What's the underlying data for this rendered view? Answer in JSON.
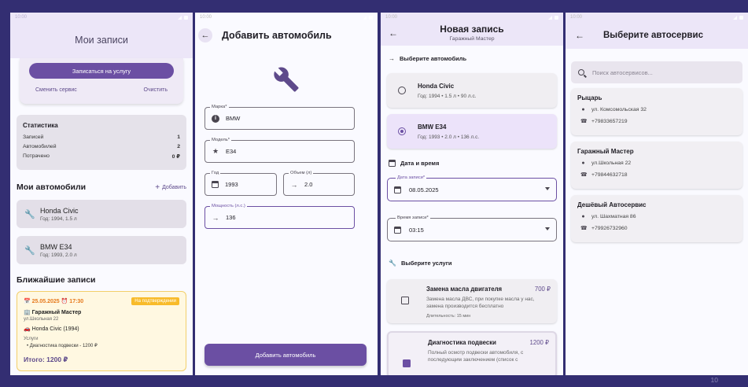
{
  "status_time": "10:00",
  "screen1": {
    "title": "Мои записи",
    "book_button": "Записаться на услугу",
    "change_service": "Сменить сервис",
    "clear": "Очистить",
    "stats": {
      "title": "Статистика",
      "rows": [
        {
          "label": "Записей",
          "value": "1"
        },
        {
          "label": "Автомобилей",
          "value": "2"
        },
        {
          "label": "Потрачено",
          "value": "0 ₽"
        }
      ]
    },
    "my_cars_title": "Мои автомобили",
    "add_label": "Добавить",
    "cars": [
      {
        "name": "Honda Civic",
        "sub": "Год: 1994, 1.5 л"
      },
      {
        "name": "BMW E34",
        "sub": "Год: 1993, 2.0 л"
      }
    ],
    "upcoming_title": "Ближайшие записи",
    "appointment": {
      "datetime": "📅 25.05.2025 ⏰ 17:30",
      "badge": "На подтверждении",
      "service": "🏢 Гаражный Мастер",
      "address": "ул.Школьная 22",
      "car": "🚗 Honda Civic (1994)",
      "services_label": "Услуги",
      "services_item": "• Диагностика подвески - 1200 ₽",
      "total": "Итого: 1200 ₽"
    }
  },
  "screen2": {
    "title": "Добавить автомобиль",
    "fields": {
      "brand_label": "Марка*",
      "brand_value": "BMW",
      "model_label": "Модель*",
      "model_value": "E34",
      "year_label": "Год",
      "year_value": "1993",
      "volume_label": "Объем (л)",
      "volume_value": "2.0",
      "power_label": "Мощность (л.с.)",
      "power_value": "136"
    },
    "submit": "Добавить автомобиль"
  },
  "screen3": {
    "title": "Новая запись",
    "subtitle": "Гаражный Мастер",
    "choose_car": "Выберите автомобиль",
    "cars": [
      {
        "name": "Honda Civic",
        "sub": "Год: 1994 • 1.5 л • 90 л.с.",
        "selected": false
      },
      {
        "name": "BMW E34",
        "sub": "Год: 1993 • 2.0 л • 136 л.с.",
        "selected": true
      }
    ],
    "datetime_title": "Дата и время",
    "date_label": "Дата записи*",
    "date_value": "08.05.2025",
    "time_label": "Время записи*",
    "time_value": "03:15",
    "services_title": "Выберите услуги",
    "services": [
      {
        "name": "Замена масла двигателя",
        "price": "700 ₽",
        "desc": "Замена масла ДВС, при покупке масла у нас, замена производится бесплатно",
        "duration": "Длительность: 15 мин",
        "checked": false
      },
      {
        "name": "Диагностика подвески",
        "price": "1200 ₽",
        "desc": "Полный осмотр подвески автомобиля, с последующим заключением (список с",
        "checked": true
      }
    ]
  },
  "screen4": {
    "title": "Выберите автосервис",
    "search_placeholder": "Поиск автосервисов...",
    "shops": [
      {
        "name": "Рыцарь",
        "address": "ул. Комсомольская 32",
        "phone": "+79833657219"
      },
      {
        "name": "Гаражный Мастер",
        "address": "ул.Школьная 22",
        "phone": "+79844632718"
      },
      {
        "name": "Дешёвый Автосервис",
        "address": "ул. Шахматная 86",
        "phone": "+79926732960"
      }
    ]
  },
  "page_number": "10",
  "colors": {
    "background": "#332e72",
    "primary": "#6b4fa3",
    "appbar": "#ece6f8",
    "warning": "#f8bb2a"
  }
}
